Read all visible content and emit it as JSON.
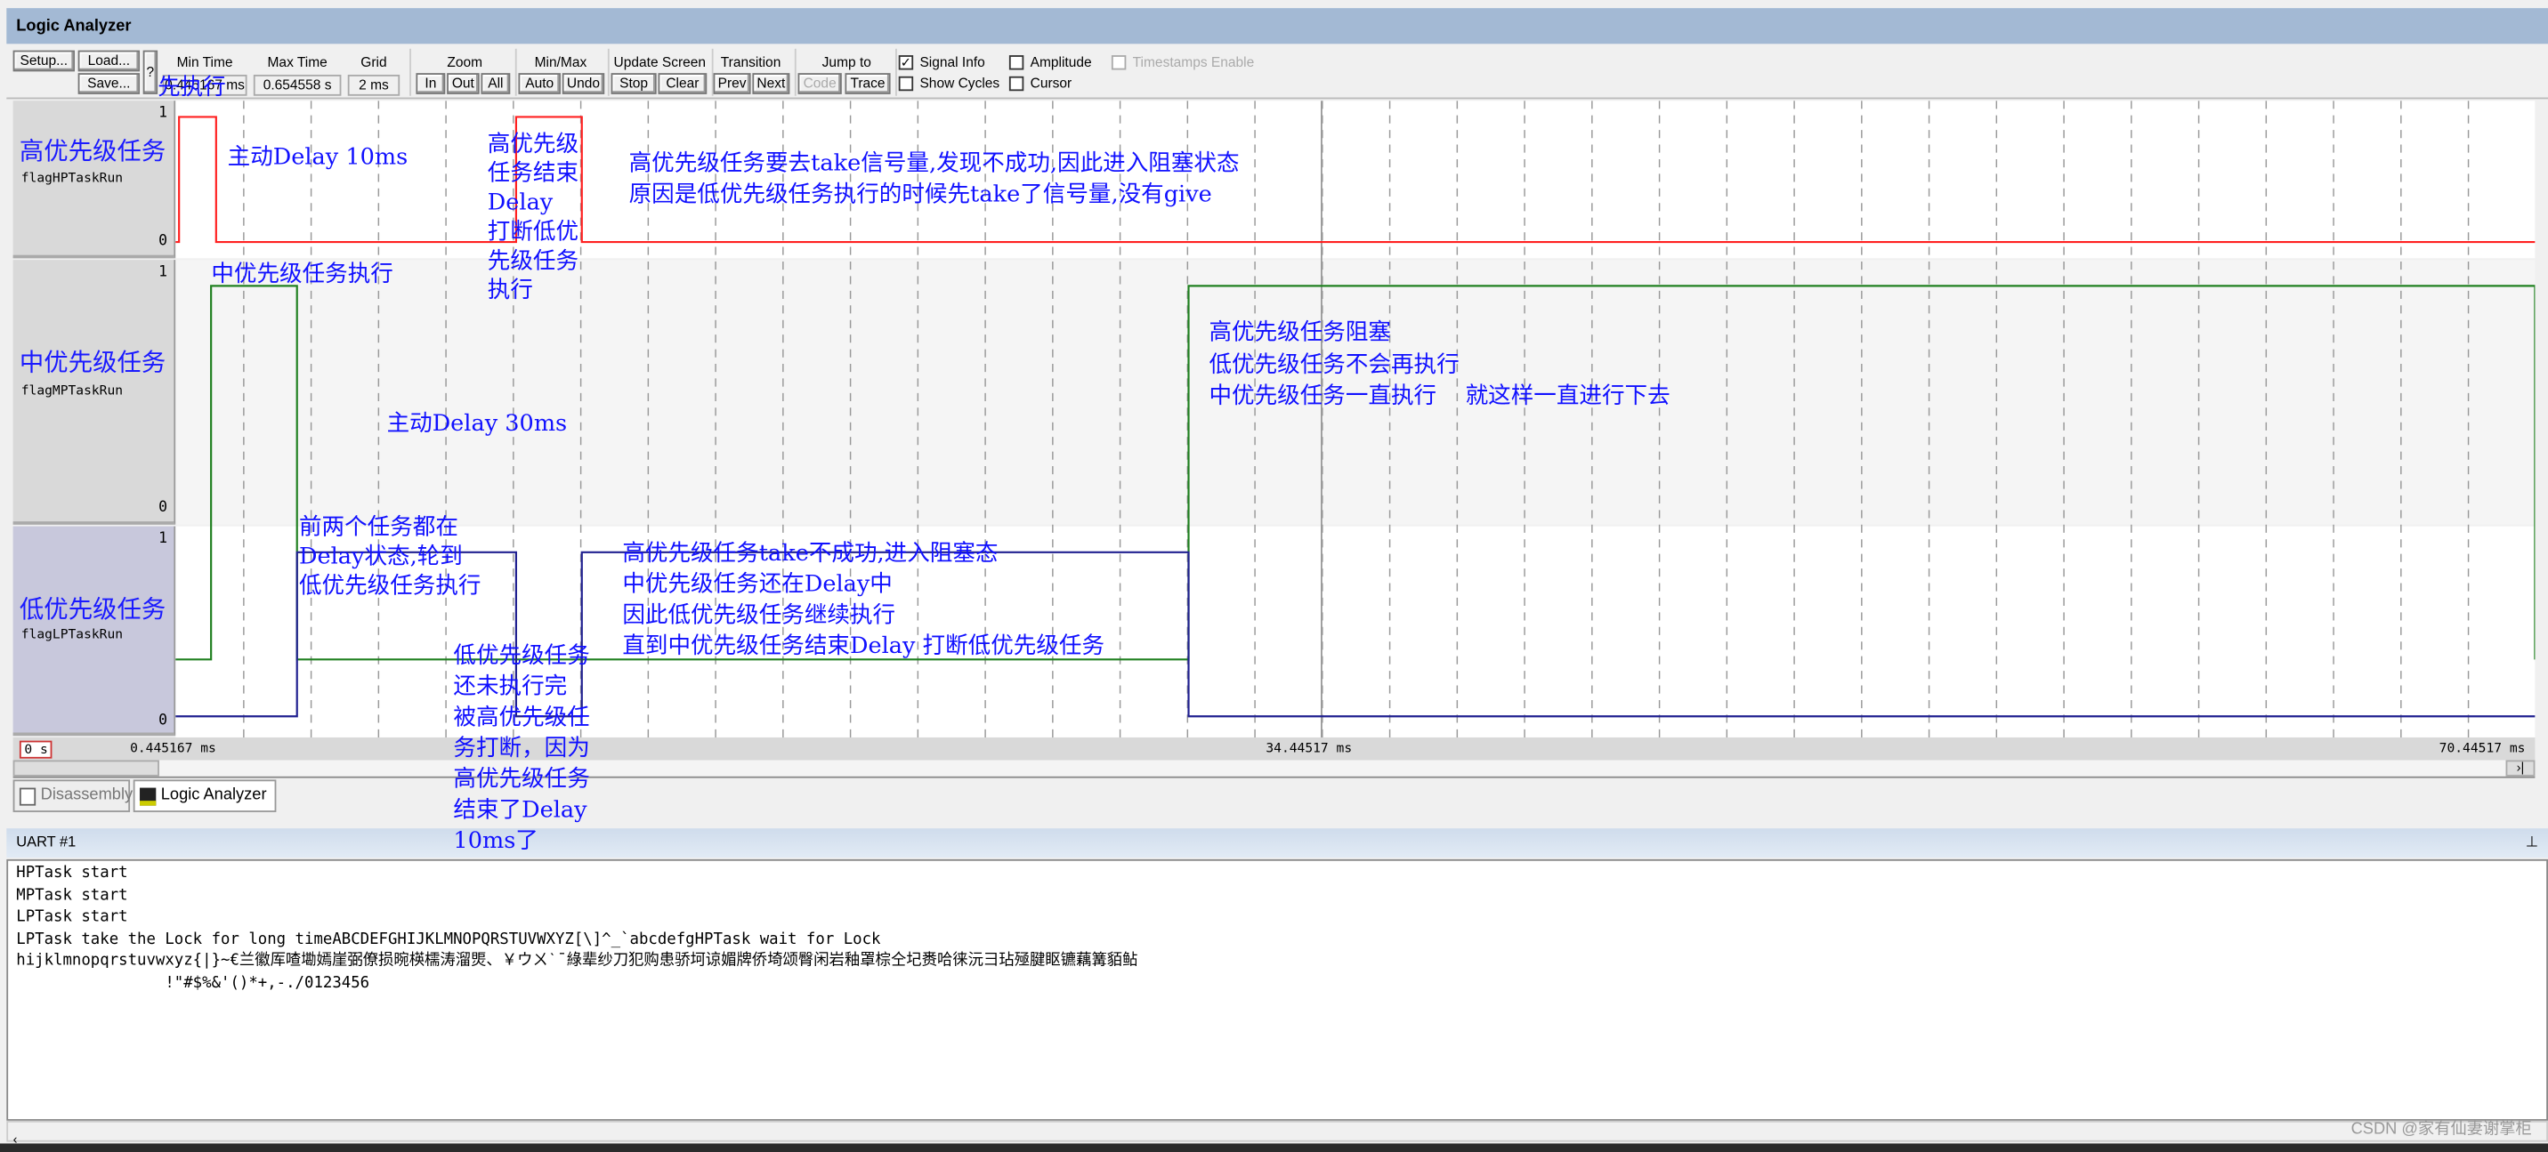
{
  "window": {
    "title": "Logic Analyzer"
  },
  "toolbar": {
    "setup": "Setup...",
    "load": "Load...",
    "save": "Save...",
    "help": "?",
    "min_time_label": "Min Time",
    "min_time": "0.445167 ms",
    "max_time_label": "Max Time",
    "max_time": "0.654558 s",
    "grid_label": "Grid",
    "grid": "2 ms",
    "zoom_label": "Zoom",
    "zoom_in": "In",
    "zoom_out": "Out",
    "zoom_all": "All",
    "minmax_label": "Min/Max",
    "auto": "Auto",
    "undo": "Undo",
    "update_label": "Update Screen",
    "stop": "Stop",
    "clear": "Clear",
    "transition_label": "Transition",
    "prev": "Prev",
    "next": "Next",
    "jump_label": "Jump to",
    "code": "Code",
    "trace": "Trace",
    "signal_info": "Signal Info",
    "signal_info_checked": true,
    "show_cycles": "Show Cycles",
    "show_cycles_checked": false,
    "amplitude": "Amplitude",
    "amplitude_checked": false,
    "cursor": "Cursor",
    "cursor_checked": false,
    "timestamps": "Timestamps Enable",
    "timestamps_checked": false
  },
  "signals": [
    {
      "label": "高优先级任务",
      "name": "flagHPTaskRun",
      "high": "1",
      "low": "0",
      "color": "#ff2020"
    },
    {
      "label": "中优先级任务",
      "name": "flagMPTaskRun",
      "high": "1",
      "low": "0",
      "color": "#208020"
    },
    {
      "label": "低优先级任务",
      "name": "flagLPTaskRun",
      "high": "1",
      "low": "0",
      "color": "#202090"
    }
  ],
  "chart_data": {
    "type": "line",
    "xunit": "ms",
    "xlim": [
      0.445167,
      70.44517
    ],
    "grid_ms": 2,
    "series": [
      {
        "signal": "flagHPTaskRun",
        "high_intervals_ms": [
          [
            0.55,
            1.65
          ],
          [
            10.55,
            12.5
          ]
        ]
      },
      {
        "signal": "flagMPTaskRun",
        "high_intervals_ms": [
          [
            1.5,
            4.05
          ],
          [
            30.5,
            70.44517
          ]
        ]
      },
      {
        "signal": "flagLPTaskRun",
        "high_intervals_ms": [
          [
            4.05,
            10.55
          ],
          [
            12.5,
            30.5
          ]
        ]
      }
    ]
  },
  "axis": {
    "start": "0 s",
    "left": "0.445167 ms",
    "mid": "34.44517 ms",
    "right": "70.44517 ms"
  },
  "tabs": [
    {
      "label": "Disassembly"
    },
    {
      "label": "Logic Analyzer"
    }
  ],
  "annotations": {
    "a1": "先执行",
    "a2": "主动Delay 10ms",
    "a3": "高优先级\n任务结束\nDelay\n打断低优\n先级任务\n执行",
    "a4": "高优先级任务要去take信号量,发现不成功,因此进入阻塞状态\n原因是低优先级任务执行的时候先take了信号量,没有give",
    "a5": "中优先级任务执行",
    "a6": "主动Delay 30ms",
    "a7": "前两个任务都在\nDelay状态,轮到\n低优先级任务执行",
    "a8": "低优先级任务\n还未执行完\n被高优先级任\n务打断，因为\n高优先级任务\n结束了Delay\n10ms了",
    "a9": "高优先级任务take不成功,进入阻塞态\n中优先级任务还在Delay中\n因此低优先级任务继续执行\n直到中优先级任务结束Delay 打断低优先级任务",
    "a10": "高优先级任务阻塞\n低优先级任务不会再执行\n中优先级任务一直执行    就这样一直进行下去"
  },
  "uart": {
    "title": "UART #1",
    "lines": "HPTask start\nMPTask start\nLPTask start\nLPTask take the Lock for long timeABCDEFGHIJKLMNOPQRSTUVWXYZ[\\]^_`abcdefgHPTask wait for Lock\nhijklmnopqrstuvwxyz{|}~€兰徽厍喳墈嫣崖弼僚损晼楧檽涛溜煚、￥ウㄨˋˉ綠辈纱刀犯购患骄坷谅媚牌侨埼颂臀闲岩釉罩棕仝圮赉哈徕沅彐玷殛腱眍镳藕篝貊鲇\n                !\"#$%&'()*+,-./0123456"
  },
  "watermark": "CSDN @家有仙妻谢掌柜"
}
